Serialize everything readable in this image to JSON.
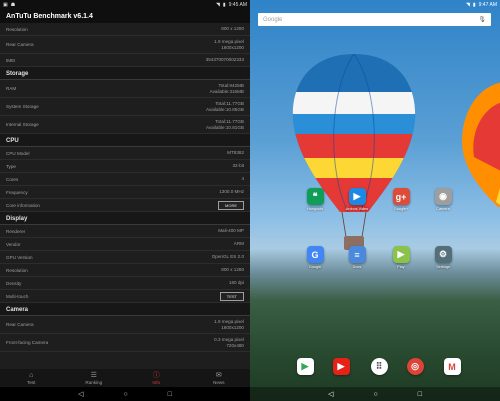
{
  "left": {
    "status": {
      "time": "9:45 AM"
    },
    "app_title": "AnTuTu Benchmark v6.1.4",
    "rows_top": [
      {
        "label": "Resolution",
        "value": "800 x 1280"
      },
      {
        "label": "Rear Camera",
        "value": "1.9 mega pixel\n1600x1200"
      },
      {
        "label": "IMEI",
        "value": "354370070002333"
      }
    ],
    "storage": {
      "title": "Storage",
      "rows": [
        {
          "label": "RAM",
          "value": "Total:942MB\nAvailable:316MB"
        },
        {
          "label": "System Storage",
          "value": "Total:11.77GB\nAvailable:10.85GB"
        },
        {
          "label": "Internal Storage",
          "value": "Total:11.77GB\nAvailable:10.81GB"
        }
      ]
    },
    "cpu": {
      "title": "CPU",
      "rows": [
        {
          "label": "CPU Model",
          "value": "MT8382"
        },
        {
          "label": "Type",
          "value": "32-bit"
        },
        {
          "label": "Cores",
          "value": "4"
        },
        {
          "label": "Frequency",
          "value": "1300.0 MHz"
        }
      ],
      "more_label": "Core information",
      "more_button": "MORE"
    },
    "display": {
      "title": "Display",
      "rows": [
        {
          "label": "Renderer",
          "value": "Mali-400 MP"
        },
        {
          "label": "Vendor",
          "value": "ARM"
        },
        {
          "label": "GPU Version",
          "value": "OpenGL ES 2.0"
        },
        {
          "label": "Resolution",
          "value": "800 x 1280"
        },
        {
          "label": "Density",
          "value": "160 dpi"
        }
      ],
      "test_label": "Multi-touch",
      "test_button": "TEST"
    },
    "camera": {
      "title": "Camera",
      "rows": [
        {
          "label": "Rear Camera",
          "value": "1.9 mega pixel\n1600x1200"
        },
        {
          "label": "Front-facing Camera",
          "value": "0.3 mega pixel\n720x480"
        }
      ]
    },
    "tabs": [
      {
        "label": "Test",
        "icon": "home-icon",
        "glyph": "⌂"
      },
      {
        "label": "Ranking",
        "icon": "ranking-icon",
        "glyph": "☰"
      },
      {
        "label": "Info",
        "icon": "info-icon",
        "glyph": "ⓘ"
      },
      {
        "label": "News",
        "icon": "news-icon",
        "glyph": "✉"
      }
    ],
    "active_tab": 2,
    "accent": "#e53935"
  },
  "right": {
    "status": {
      "time": "9:47 AM"
    },
    "search_placeholder": "Google",
    "apps": [
      {
        "label": "Hangouts",
        "color": "#0f9d58",
        "glyph": "❝"
      },
      {
        "label": "Archos Video",
        "color": "#1e88e5",
        "glyph": "▶"
      },
      {
        "label": "Google+",
        "color": "#dd4b39",
        "glyph": "g+"
      },
      {
        "label": "Camera",
        "color": "#9e9e9e",
        "glyph": "◉"
      },
      {
        "label": "Google",
        "color": "#4285f4",
        "glyph": "G"
      },
      {
        "label": "Docs",
        "color": "#4a89dc",
        "glyph": "≡"
      },
      {
        "label": "Play",
        "color": "#8bc34a",
        "glyph": "▶"
      },
      {
        "label": "Settings",
        "color": "#546e7a",
        "glyph": "⚙"
      }
    ],
    "dock": [
      {
        "name": "play-store",
        "color": "#ffffff",
        "glyph": "▶",
        "fg": "#34a853"
      },
      {
        "name": "youtube",
        "color": "#e62117",
        "glyph": "▶",
        "fg": "#ffffff"
      },
      {
        "name": "app-drawer",
        "color": "#ffffff",
        "glyph": "⠿",
        "fg": "#555555"
      },
      {
        "name": "chrome",
        "color": "#db4437",
        "glyph": "◎",
        "fg": "#ffffff"
      },
      {
        "name": "gmail",
        "color": "#ffffff",
        "glyph": "M",
        "fg": "#db4437"
      }
    ]
  }
}
